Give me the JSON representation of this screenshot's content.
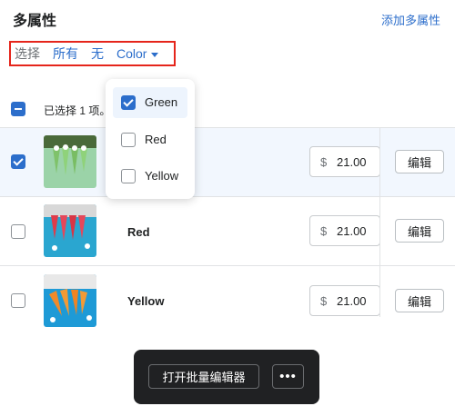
{
  "header": {
    "title": "多属性",
    "add_link": "添加多属性"
  },
  "filter_bar": {
    "select_label": "选择",
    "all_link": "所有",
    "none_link": "无",
    "color_dropdown": "Color"
  },
  "selection": {
    "text": "已选择 1 项。"
  },
  "dropdown": {
    "options": [
      {
        "label": "Green",
        "checked": true
      },
      {
        "label": "Red",
        "checked": false
      },
      {
        "label": "Yellow",
        "checked": false
      }
    ]
  },
  "variants": [
    {
      "name": "Green",
      "currency": "$",
      "price": "21.00",
      "edit_label": "编辑",
      "selected": true
    },
    {
      "name": "Red",
      "currency": "$",
      "price": "21.00",
      "edit_label": "编辑",
      "selected": false
    },
    {
      "name": "Yellow",
      "currency": "$",
      "price": "21.00",
      "edit_label": "编辑",
      "selected": false
    }
  ],
  "bulk_bar": {
    "open_editor_label": "打开批量编辑器",
    "more_label": "•••"
  },
  "colors": {
    "accent": "#2c6ecb",
    "highlight_border": "#e5251b",
    "selected_row": "#f2f7fe",
    "bulk_bg": "#202123"
  }
}
